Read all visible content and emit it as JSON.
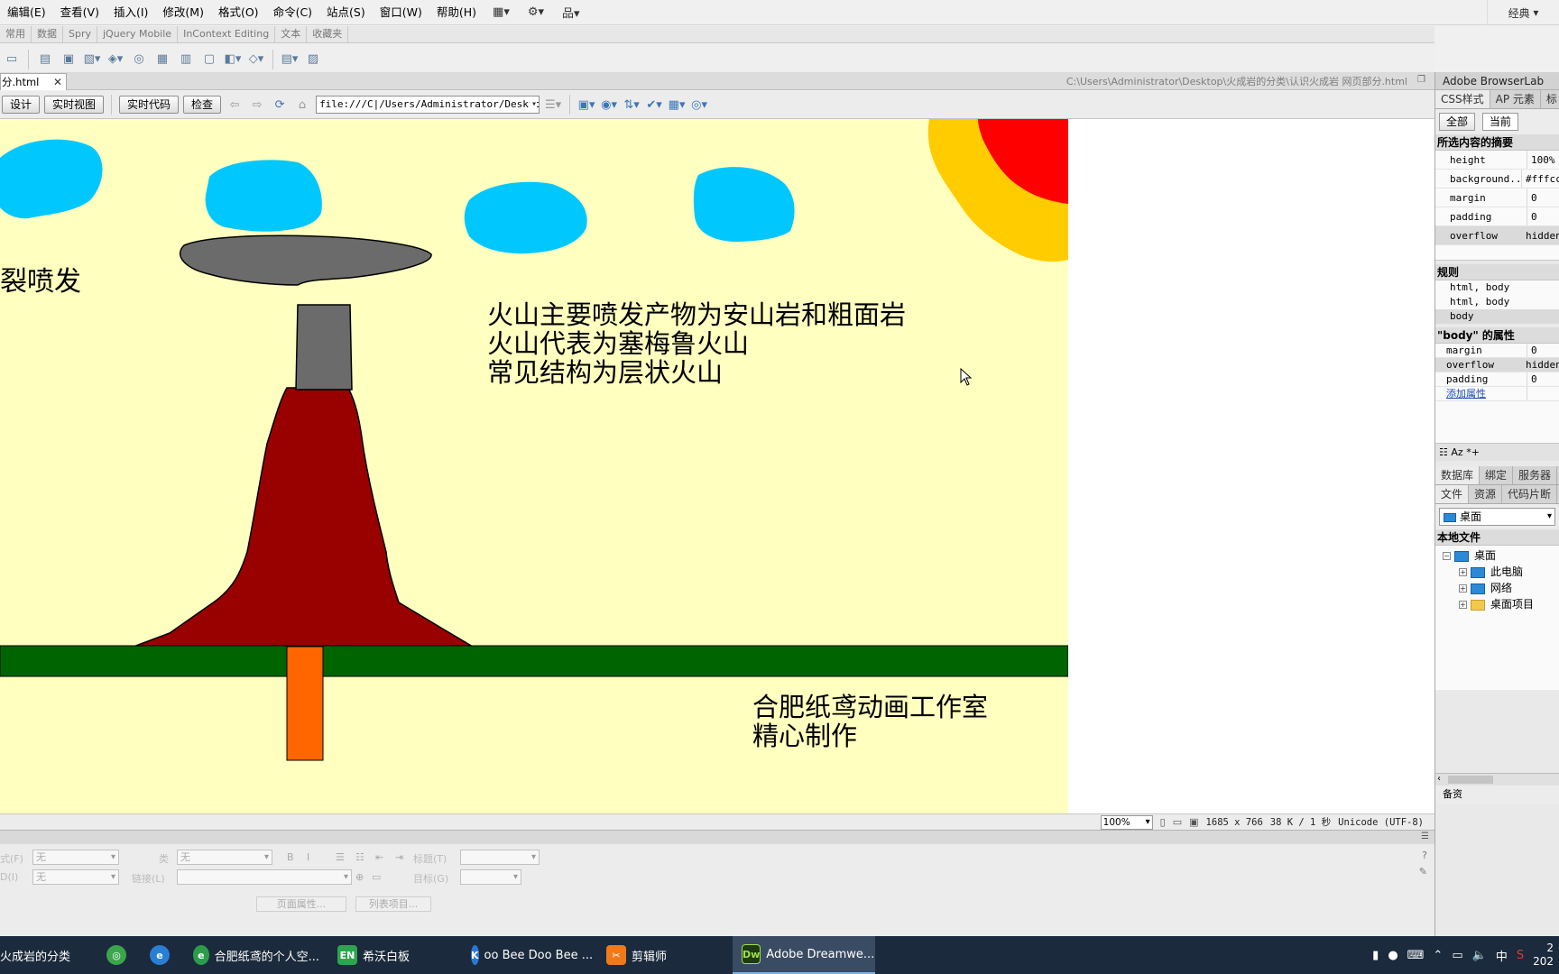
{
  "menubar": {
    "items": [
      "编辑(E)",
      "查看(V)",
      "插入(I)",
      "修改(M)",
      "格式(O)",
      "命令(C)",
      "站点(S)",
      "窗口(W)",
      "帮助(H)"
    ],
    "workspace": "经典"
  },
  "insert_tabs": [
    "常用",
    "数据",
    "Spry",
    "jQuery Mobile",
    "InContext Editing",
    "文本",
    "收藏夹"
  ],
  "doc_tab": {
    "filename": "分.html",
    "path": "C:\\Users\\Administrator\\Desktop\\火成岩的分类\\认识火成岩 网页部分.html"
  },
  "doc_toolbar": {
    "design": "设计",
    "live_view": "实时视图",
    "live_code": "实时代码",
    "inspect": "检查",
    "address": "file:///C|/Users/Administrator/Desktop"
  },
  "canvas": {
    "left_text": "裂喷发",
    "info_lines": [
      "火山主要喷发产物为安山岩和粗面岩",
      "火山代表为塞梅鲁火山",
      "常见结构为层状火山"
    ],
    "credit_lines": [
      "合肥纸鸢动画工作室",
      "精心制作"
    ],
    "colors": {
      "background": "#ffffc0",
      "cloud": "#00c8ff",
      "ground": "#006400",
      "volcano": "#990000",
      "chimney": "#6b6b6b",
      "post": "#ff6600",
      "sun_outer": "#ffcc00",
      "sun_inner": "#ff0000"
    }
  },
  "statusbar": {
    "zoom": "100%",
    "dimensions": "1685 x 766",
    "size_time": "38 K / 1 秒",
    "encoding": "Unicode (UTF-8)"
  },
  "properties": {
    "format_label": "式(F)",
    "format_value": "无",
    "id_label": "D(I)",
    "id_value": "无",
    "class_label": "类",
    "class_value": "无",
    "link_label": "链接(L)",
    "title_label": "标题(T)",
    "target_label": "目标(G)",
    "page_props_btn": "页面属性...",
    "list_item_btn": "列表项目..."
  },
  "right_panel": {
    "browserlab_title": "Adobe BrowserLab",
    "css_tabs": [
      "CSS样式",
      "AP 元素",
      "标"
    ],
    "mode_all": "全部",
    "mode_current": "当前",
    "summary_title": "所选内容的摘要",
    "summary": [
      {
        "name": "height",
        "value": "100%"
      },
      {
        "name": "background...",
        "value": "#fffcc"
      },
      {
        "name": "margin",
        "value": "0"
      },
      {
        "name": "padding",
        "value": "0"
      },
      {
        "name": "overflow",
        "value": "hidden"
      }
    ],
    "rules_title": "规则",
    "rules": [
      "html, body",
      "html, body",
      "body"
    ],
    "props_title": "\"body\" 的属性",
    "body_props": [
      {
        "name": "margin",
        "value": "0"
      },
      {
        "name": "overflow",
        "value": "hidden"
      },
      {
        "name": "padding",
        "value": "0"
      }
    ],
    "add_property": "添加属性",
    "db_tabs": [
      "数据库",
      "绑定",
      "服务器"
    ],
    "file_tabs": [
      "文件",
      "资源",
      "代码片断"
    ],
    "location": "桌面",
    "local_files": "本地文件",
    "tree": [
      {
        "label": "桌面",
        "level": 0,
        "toggle": "−",
        "icon": "monitor"
      },
      {
        "label": "此电脑",
        "level": 1,
        "toggle": "+",
        "icon": "monitor"
      },
      {
        "label": "网络",
        "level": 1,
        "toggle": "+",
        "icon": "monitor"
      },
      {
        "label": "桌面项目",
        "level": 1,
        "toggle": "+",
        "icon": "folder"
      }
    ],
    "log_label": "备资"
  },
  "taskbar": {
    "items": [
      {
        "label": "火成岩的分类",
        "icon": ""
      },
      {
        "label": "",
        "icon": "360"
      },
      {
        "label": "",
        "icon": "e"
      },
      {
        "label": "合肥纸鸢的个人空...",
        "icon": "e"
      },
      {
        "label": "希沃白板",
        "icon": "EN"
      },
      {
        "label": "oo Bee Doo Bee ...",
        "icon": "K"
      },
      {
        "label": "剪辑师",
        "icon": "剪"
      },
      {
        "label": "Adobe Dreamwe...",
        "icon": "Dw"
      }
    ],
    "ime": "中",
    "clock_time": "2",
    "clock_date": "202"
  }
}
